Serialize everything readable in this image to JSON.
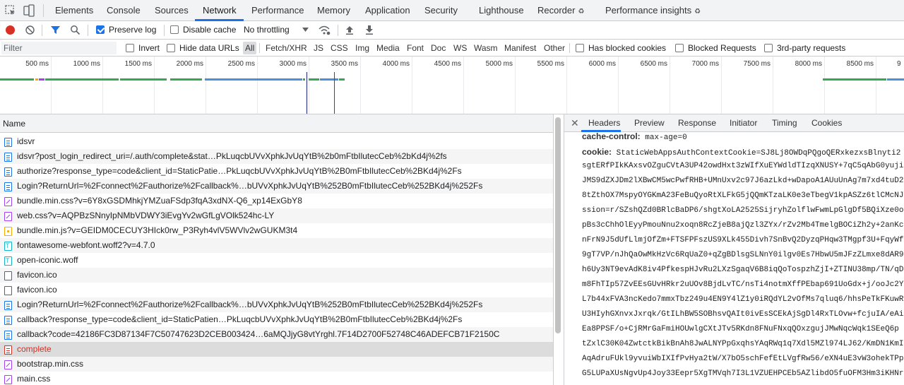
{
  "tabs": [
    {
      "label": "Elements"
    },
    {
      "label": "Console"
    },
    {
      "label": "Sources"
    },
    {
      "label": "Network",
      "active": true
    },
    {
      "label": "Performance"
    },
    {
      "label": "Memory"
    },
    {
      "label": "Application"
    },
    {
      "label": "Security"
    },
    {
      "label": "Lighthouse"
    },
    {
      "label": "Recorder",
      "experimental": true
    },
    {
      "label": "Performance insights",
      "experimental": true
    }
  ],
  "toolbar": {
    "preserve_log": "Preserve log",
    "preserve_log_checked": true,
    "disable_cache": "Disable cache",
    "disable_cache_checked": false,
    "throttling": "No throttling"
  },
  "filter": {
    "placeholder": "Filter",
    "invert": "Invert",
    "hide_data_urls": "Hide data URLs",
    "types": [
      "All",
      "Fetch/XHR",
      "JS",
      "CSS",
      "Img",
      "Media",
      "Font",
      "Doc",
      "WS",
      "Wasm",
      "Manifest",
      "Other"
    ],
    "active_type": "All",
    "has_blocked_cookies": "Has blocked cookies",
    "blocked_requests": "Blocked Requests",
    "third_party": "3rd-party requests"
  },
  "overview": {
    "ticks": [
      "500 ms",
      "1000 ms",
      "1500 ms",
      "2000 ms",
      "2500 ms",
      "3000 ms",
      "3500 ms",
      "4000 ms",
      "4500 ms",
      "5000 ms",
      "5500 ms",
      "6000 ms",
      "6500 ms",
      "7000 ms",
      "7500 ms",
      "8000 ms",
      "8500 ms",
      "9"
    ]
  },
  "requests": {
    "header": "Name",
    "rows": [
      {
        "name": "idsvr",
        "type": "doc"
      },
      {
        "name": "idsvr?post_login_redirect_uri=/.auth/complete&stat…PkLuqcbUVvXphkJvUqYtB%2b0mFtbIlutecCeb%2bKd4j%2fs",
        "type": "doc"
      },
      {
        "name": "authorize?response_type=code&client_id=StaticPatie…PkLuqcbUVvXphkJvUqYtB%2B0mFtbIlutecCeb%2BKd4j%2Fs",
        "type": "doc"
      },
      {
        "name": "Login?ReturnUrl=%2Fconnect%2Fauthorize%2Fcallback%…bUVvXphkJvUqYtB%252B0mFtbIlutecCeb%252BKd4j%252Fs",
        "type": "doc"
      },
      {
        "name": "bundle.min.css?v=6Y8xGSDMhkjYMZuaFSdp3fqA3xdNX-Q6_xp14ExGbY8",
        "type": "css"
      },
      {
        "name": "web.css?v=AQPBzSNnyIpNMbVDWY3iEvgYv2wGfLgVOlk524hc-LY",
        "type": "css"
      },
      {
        "name": "bundle.min.js?v=GEIDM0CECUY3HIck0rw_P3Ryh4vlV5WVlv2wGUKM3t4",
        "type": "js"
      },
      {
        "name": "fontawesome-webfont.woff2?v=4.7.0",
        "type": "font"
      },
      {
        "name": "open-iconic.woff",
        "type": "font"
      },
      {
        "name": "favicon.ico",
        "type": "blank"
      },
      {
        "name": "favicon.ico",
        "type": "blank"
      },
      {
        "name": "Login?ReturnUrl=%2Fconnect%2Fauthorize%2Fcallback%…bUVvXphkJvUqYtB%252B0mFtbIlutecCeb%252BKd4j%252Fs",
        "type": "doc"
      },
      {
        "name": "callback?response_type=code&client_id=StaticPatien…PkLuqcbUVvXphkJvUqYtB%2B0mFtbIlutecCeb%2BKd4j%2Fs",
        "type": "doc"
      },
      {
        "name": "callback?code=42186FC3D87134F7C50747623D2CEB003424…6aMQJjyG8vtYrghl.7F14D2700F52748C46ADEFCB71F2150C",
        "type": "doc"
      },
      {
        "name": "complete",
        "type": "err",
        "selected": true
      },
      {
        "name": "bootstrap.min.css",
        "type": "css"
      },
      {
        "name": "main.css",
        "type": "css"
      }
    ]
  },
  "details": {
    "tabs": [
      "Headers",
      "Preview",
      "Response",
      "Initiator",
      "Timing",
      "Cookies"
    ],
    "active_tab": "Headers",
    "cache_control_key": "cache-control:",
    "cache_control_value": "max-age=0",
    "cookie_key": "cookie:",
    "cookie_lines": [
      "StaticWebAppsAuthContextCookie=SJ8Lj8OWDqPQgoQERxkezxsBlnyti2",
      "sgtERfPIkKAxsvOZguCVtA3UP42owdHxt3zWIfXuEYWdldTIzqXNUSY+7qC5qAbG0yuji",
      "JMS9dZXJDm2lXBwCM5wcPwfRHB+UMnUxv2c97J6azLkd+wDapoA1AUuUnAg7m7xd4tuD2",
      "8tZthOX7MspyOYGKmA23FeBuQyoRtXLFkG5jQQmKTzaLK0e3eTbegV1kpASZz6tlCMcNJ",
      "ssion=r/SZshQZd0BRlcBaDP6/shgtXoLA2525SijryhZolflwFwmLpGlgDf5BQiXze0o",
      "pBs3cChhOlEyyPmouNnu2xoqn8RcZjeB8ajQzl3ZYx/rZv2Mb4TmelgBOCiZh2y+2anKc",
      "nFrN9J5dUfLlmjOfZm+FTSFPFszUS9XLk455Divh7SnBvQ2DyzqPHqw3TMgpf3U+FqyWf",
      "9gT7VP/nJhQaOwMkHzVc6RqUaZ0+qZgBDlsgSLNnY0ilgv0Es7HbwU5mJFzZLmxe8dAR9",
      "h6Uy3NT9evAdK8iv4PfkespHJvRu2LXzSgaqV6B8iqQoTospzhZjI+ZTINU38mp/TN/qD",
      "m8FhTIp57ZvEEsGUvHRkr2uUOv8BjdLvTC/nsTi4notmXffPEbap691UoGdx+j/ooJc2Y",
      "L7b44xFVA3ncKedo7mmxTbz249u4EN9Y4lZ1y0iRQdYL2vOfMs7qluq6/hhsPeTkFKuwR",
      "U3HIyhGXnvxJxrqk/GtILhBW5SOBhsvQAIt0ivEsSCEkAjSgDl4RxTLOvw+fcjuIA/eAi",
      "Ea8PPSF/o+CjRMrGaFmiHOUwlgCXtJTv5RKdn8FNuFNxqQOxzgujJMwNqcWqk1SEeQ6p",
      "tZxlC30K04ZwtctkBikBnAh8JwALNYPpGxqhsYAqRWq1q7Xdl5MZl974LJ62/KmDN1KmI",
      "AqAdruFUkl9yvuiWbIXIfPvHya2tW/X7bO5schFefEtLVgfRw56/eXN4uE3vW3ohekTPp",
      "G5LUPaXUsNgvUp4Joy33Eepr5XgTMVqh7I3L1VZUEHPCEb5AZlibdO5fuOFM3Hm3iKHNr"
    ]
  }
}
